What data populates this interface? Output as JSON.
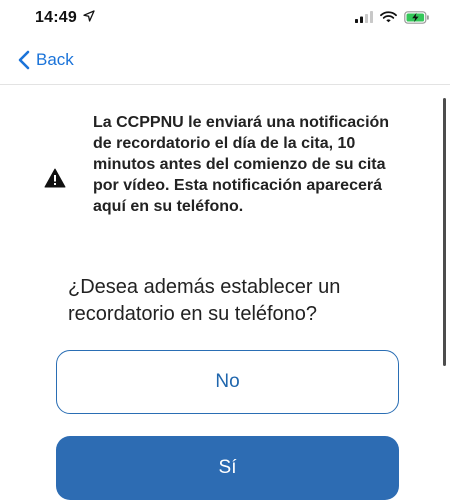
{
  "status_bar": {
    "time": "14:49",
    "icons": [
      "location-arrow-icon",
      "signal-icon",
      "wifi-icon",
      "battery-charging-icon"
    ],
    "battery_color": "#34c759"
  },
  "nav": {
    "back_label": "Back",
    "back_icon": "chevron-left-icon"
  },
  "notice": {
    "icon": "warning-icon",
    "text": "La CCPPNU le enviará una notificación de recordatorio el día de la cita, 10 minutos antes del comienzo de su cita por vídeo. Esta notificación aparecerá aquí en su teléfono."
  },
  "question": "¿Desea además establecer un recordatorio en su teléfono?",
  "buttons": {
    "no_label": "No",
    "yes_label": "Sí"
  },
  "colors": {
    "accent": "#1a73d9",
    "primary_button": "#2d6cb3",
    "text": "#222222"
  }
}
